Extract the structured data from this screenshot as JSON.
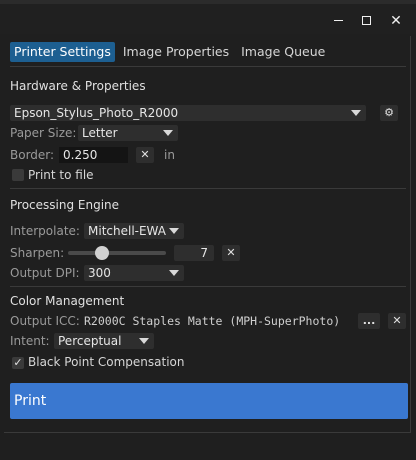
{
  "tabs": [
    {
      "label": "Printer Settings",
      "active": true
    },
    {
      "label": "Image Properties",
      "active": false
    },
    {
      "label": "Image Queue",
      "active": false
    }
  ],
  "hardware": {
    "title": "Hardware & Properties",
    "printer": "Epson_Stylus_Photo_R2000",
    "paper_size_label": "Paper Size:",
    "paper_size": "Letter",
    "border_label": "Border:",
    "border_value": "0.250",
    "border_unit": "in",
    "print_to_file_label": "Print to file",
    "print_to_file_checked": false
  },
  "processing": {
    "title": "Processing Engine",
    "interpolate_label": "Interpolate:",
    "interpolate": "Mitchell-EWA",
    "sharpen_label": "Sharpen:",
    "sharpen_value": "7",
    "output_dpi_label": "Output DPI:",
    "output_dpi": "300"
  },
  "color": {
    "title": "Color Management",
    "output_icc_label": "Output ICC:",
    "output_icc": "R2000C Staples Matte (MPH-SuperPhoto)",
    "browse_label": "...",
    "intent_label": "Intent:",
    "intent": "Perceptual",
    "bpc_label": "Black Point Compensation",
    "bpc_checked": true
  },
  "print_button": "Print",
  "colors": {
    "accent": "#3a78d0",
    "tab_active": "#1d5f91",
    "background": "#1f1f1f"
  }
}
